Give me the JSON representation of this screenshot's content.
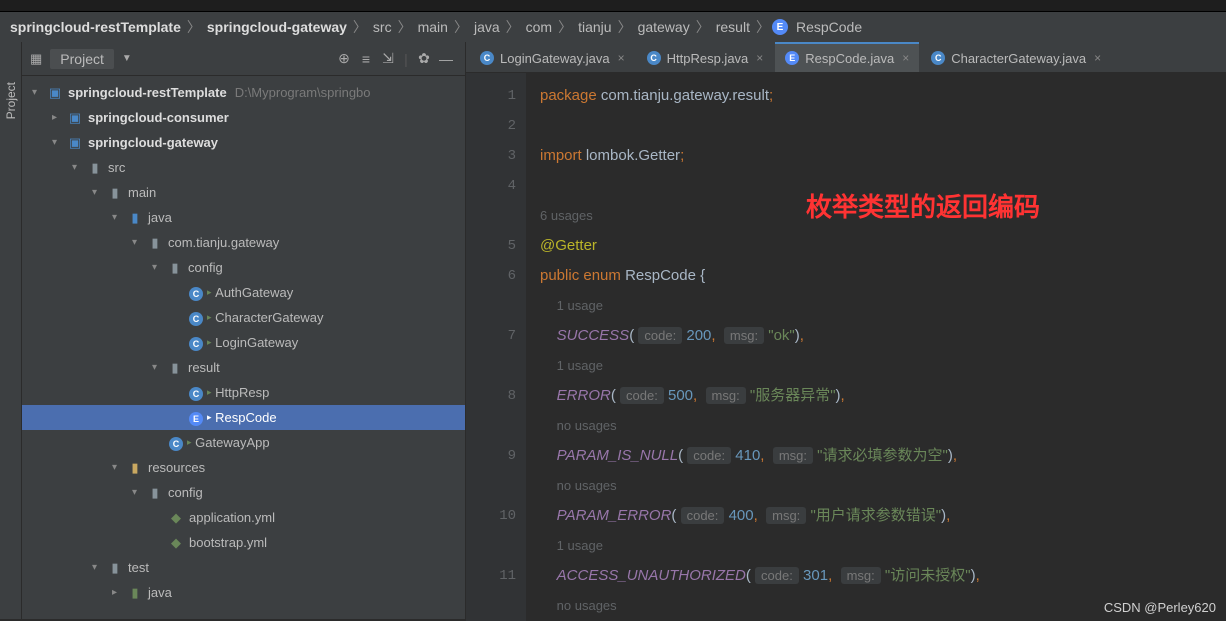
{
  "breadcrumbs": [
    "springcloud-restTemplate",
    "springcloud-gateway",
    "src",
    "main",
    "java",
    "com",
    "tianju",
    "gateway",
    "result",
    "RespCode"
  ],
  "panel": {
    "title": "Project"
  },
  "sideTab": "Project",
  "tree": {
    "root": {
      "name": "springcloud-restTemplate",
      "path": "D:\\Myprogram\\springbo"
    },
    "consumer": "springcloud-consumer",
    "gateway": "springcloud-gateway",
    "src": "src",
    "main": "main",
    "java": "java",
    "pkg": "com.tianju.gateway",
    "config": "config",
    "auth": "AuthGateway",
    "char": "CharacterGateway",
    "login": "LoginGateway",
    "result": "result",
    "http": "HttpResp",
    "resp": "RespCode",
    "app": "GatewayApp",
    "resources": "resources",
    "config2": "config",
    "appyml": "application.yml",
    "bootyml": "bootstrap.yml",
    "test": "test",
    "java2": "java"
  },
  "tabs": [
    {
      "label": "LoginGateway.java",
      "icon": "C",
      "active": false
    },
    {
      "label": "HttpResp.java",
      "icon": "C",
      "active": false
    },
    {
      "label": "RespCode.java",
      "icon": "E",
      "active": true
    },
    {
      "label": "CharacterGateway.java",
      "icon": "C",
      "active": false
    }
  ],
  "code": {
    "package": "package ",
    "pkgName": "com.tianju.gateway.result",
    "import": "import ",
    "importName": "lombok.Getter",
    "usages6": "6 usages",
    "getter": "@Getter",
    "public": "public ",
    "enum": "enum ",
    "className": "RespCode ",
    "brace": "{",
    "u1": "1 usage",
    "u0": "no usages",
    "success": "SUCCESS",
    "error": "ERROR",
    "paramNull": "PARAM_IS_NULL",
    "paramErr": "PARAM_ERROR",
    "access": "ACCESS_UNAUTHORIZED",
    "codeHint": "code:",
    "msgHint": "msg:",
    "v200": "200",
    "v500": "500",
    "v410": "410",
    "v400": "400",
    "v301": "301",
    "ok": "\"ok\"",
    "serverErr": "\"服务器异常\"",
    "nullMsg": "\"请求必填参数为空\"",
    "paramMsg": "\"用户请求参数错误\"",
    "accessMsg": "\"访问未授权\""
  },
  "annotation": "枚举类型的返回编码",
  "watermark": "CSDN @Perley620"
}
